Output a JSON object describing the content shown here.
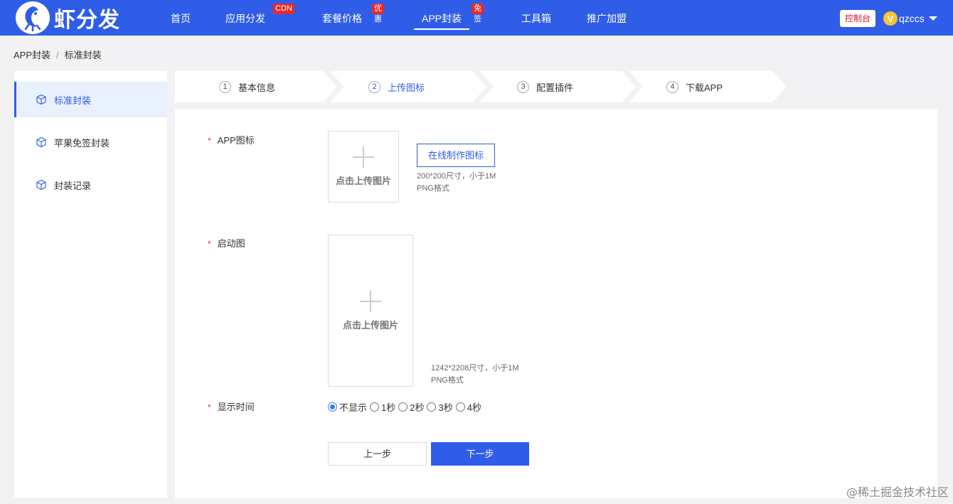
{
  "header": {
    "logo_text": "虾分发",
    "nav": [
      {
        "label": "首页",
        "badge": ""
      },
      {
        "label": "应用分发",
        "badge": "CDN"
      },
      {
        "label": "套餐价格",
        "badge": "优惠"
      },
      {
        "label": "APP封装",
        "badge": "免签"
      },
      {
        "label": "工具箱",
        "badge": ""
      },
      {
        "label": "推广加盟",
        "badge": ""
      }
    ],
    "console_label": "控制台",
    "user": {
      "avatar_letter": "V",
      "name": "qzccs"
    }
  },
  "breadcrumb": {
    "root": "APP封装",
    "separator": "/",
    "current": "标准封装"
  },
  "sidebar": {
    "items": [
      {
        "label": "标准封装"
      },
      {
        "label": "苹果免签封装"
      },
      {
        "label": "封装记录"
      }
    ]
  },
  "steps": [
    {
      "num": "1",
      "label": "基本信息"
    },
    {
      "num": "2",
      "label": "上传图标"
    },
    {
      "num": "3",
      "label": "配置插件"
    },
    {
      "num": "4",
      "label": "下载APP"
    }
  ],
  "form": {
    "required_mark": "*",
    "app_icon": {
      "label": "APP图标",
      "upload_text": "点击上传图片",
      "make_button": "在线制作图标",
      "hint_size": "200*200尺寸，小于1M",
      "hint_format": "PNG格式"
    },
    "splash": {
      "label": "启动图",
      "upload_text": "点击上传图片",
      "hint_size": "1242*2208尺寸，小于1M",
      "hint_format": "PNG格式"
    },
    "display_time": {
      "label": "显示时间",
      "options": [
        "不显示",
        "1秒",
        "2秒",
        "3秒",
        "4秒"
      ],
      "selected": "不显示"
    },
    "prev_button": "上一步",
    "next_button": "下一步"
  },
  "watermark": "@稀土掘金技术社区",
  "colors": {
    "primary": "#2f5de8",
    "badge": "#e52b2b",
    "active_bg": "#e8f1fd"
  }
}
